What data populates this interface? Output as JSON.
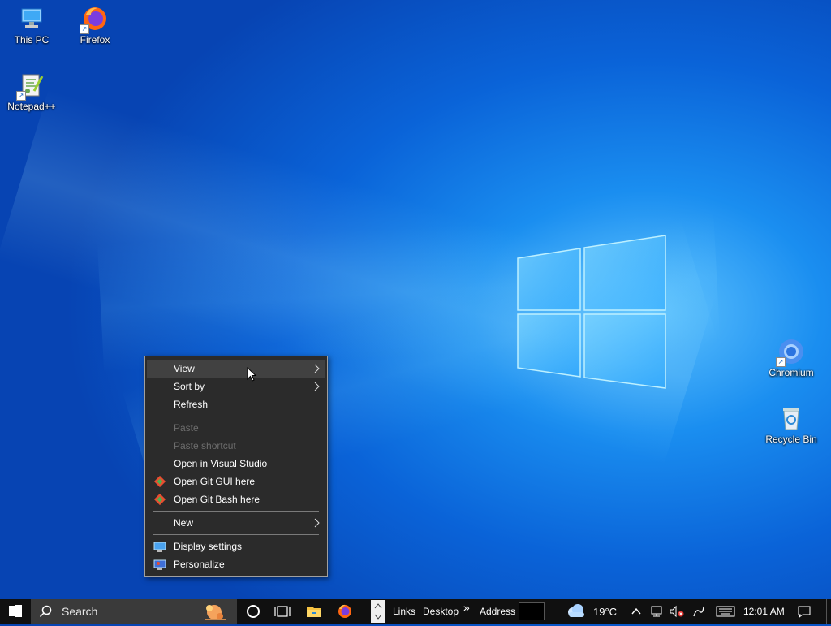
{
  "desktop": {
    "icons": [
      {
        "label": "This PC",
        "icon": "computer-icon"
      },
      {
        "label": "Firefox",
        "icon": "firefox-icon"
      },
      {
        "label": "Notepad++",
        "icon": "notepadpp-icon"
      },
      {
        "label": "Chromium",
        "icon": "chromium-icon"
      },
      {
        "label": "Recycle Bin",
        "icon": "recycle-bin-icon"
      }
    ]
  },
  "context_menu": {
    "items": [
      {
        "label": "View",
        "submenu": true,
        "state": "hover"
      },
      {
        "label": "Sort by",
        "submenu": true
      },
      {
        "label": "Refresh"
      },
      {
        "label": "Paste",
        "disabled": true
      },
      {
        "label": "Paste shortcut",
        "disabled": true
      },
      {
        "label": "Open in Visual Studio"
      },
      {
        "label": "Open Git GUI here",
        "icon": "git-icon"
      },
      {
        "label": "Open Git Bash here",
        "icon": "git-icon"
      },
      {
        "label": "New",
        "submenu": true
      },
      {
        "label": "Display settings",
        "icon": "display-icon"
      },
      {
        "label": "Personalize",
        "icon": "personalize-icon"
      }
    ]
  },
  "taskbar": {
    "search_placeholder": "Search",
    "toolbar_links": "Links",
    "toolbar_desktop": "Desktop",
    "toolbar_overflow": "»",
    "address_label": "Address",
    "weather_temp": "19°C",
    "clock": "12:01 AM"
  },
  "colors": {
    "menu_bg": "#2b2b2b",
    "menu_hover": "#414141",
    "taskbar_bg": "#101010",
    "accent": "#0a63d8"
  }
}
